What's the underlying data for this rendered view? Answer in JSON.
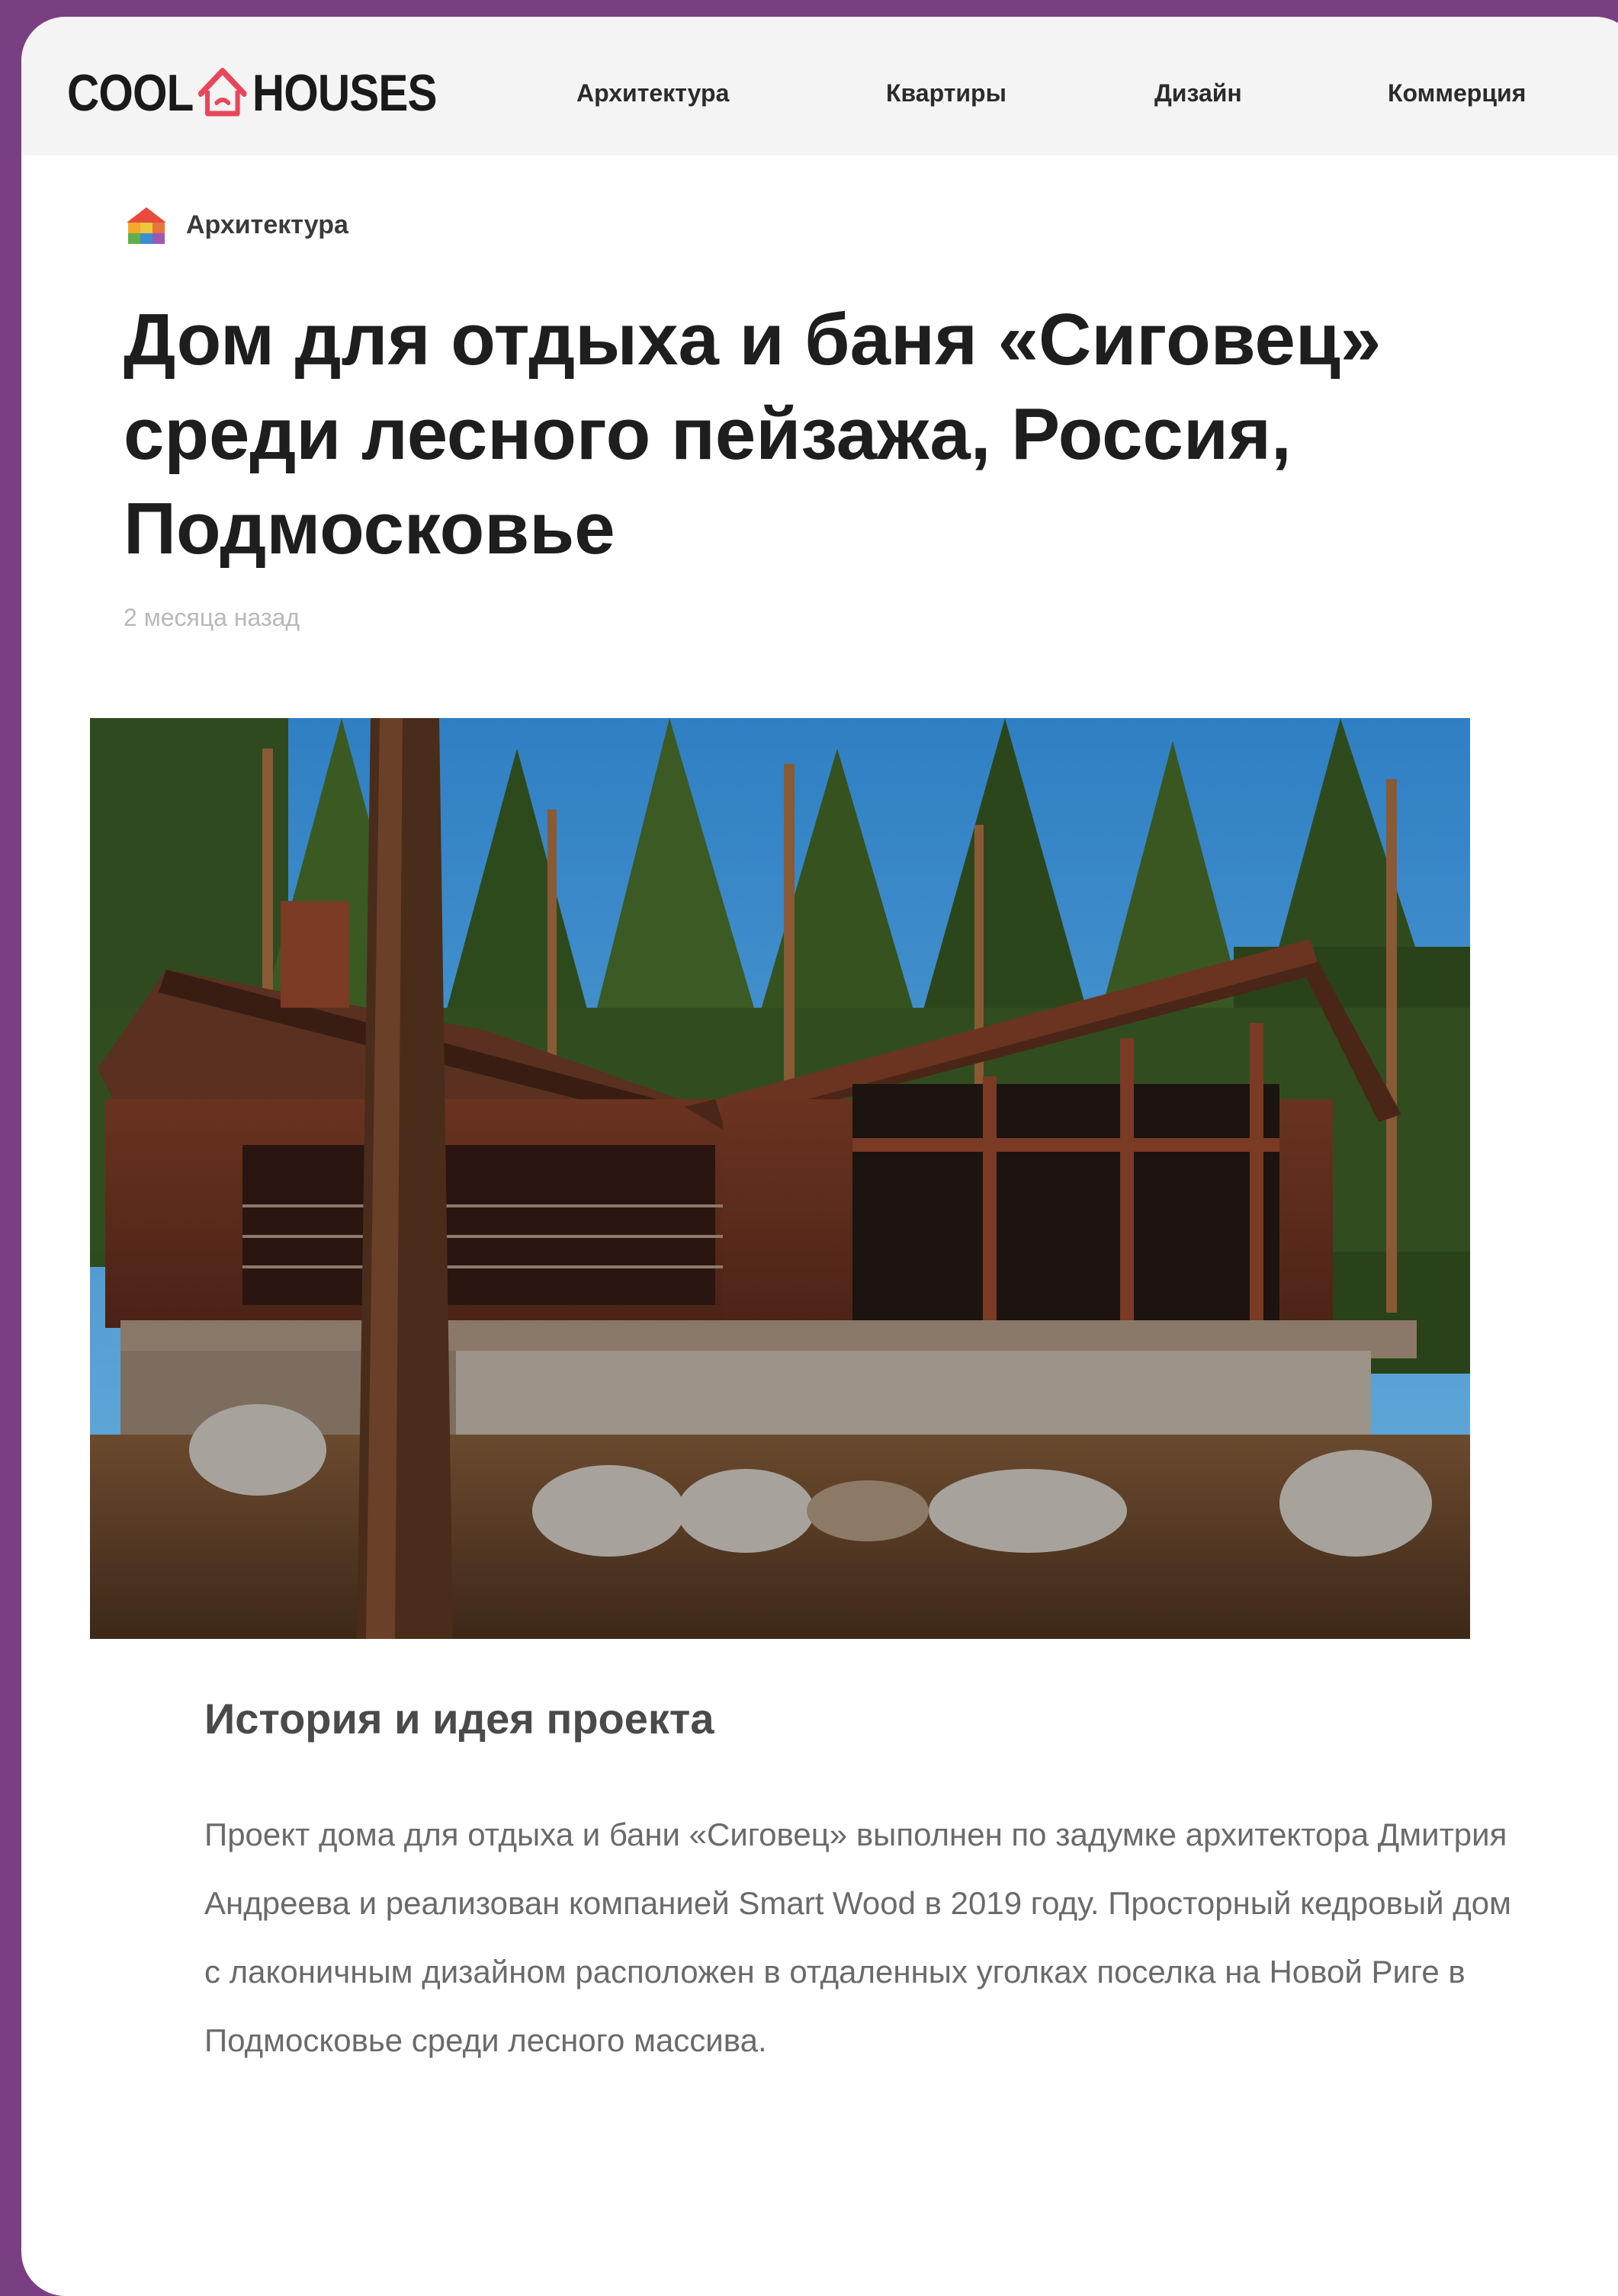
{
  "header": {
    "logo": {
      "left": "COOL",
      "right": "HOUSES"
    },
    "nav": [
      "Архитектура",
      "Квартиры",
      "Дизайн",
      "Коммерция"
    ]
  },
  "article": {
    "category": "Архитектура",
    "title": "Дом для отдыха и баня «Сиговец» среди лесного пейзажа, Россия, Подмосковье",
    "date": "2 месяца назад",
    "section_title": "История и идея проекта",
    "paragraph": "Проект дома для отдыха и бани «Сиговец» выполнен по задумке архитектора Дмитрия Андреева и реализован компанией Smart Wood в 2019 году. Просторный кедровый дом с лаконичным дизайном расположен в отдаленных уголках поселка на Новой Риге в Подмосковье среди лесного массива."
  },
  "colors": {
    "outer_background": "#7a3f82",
    "logo_accent": "#e8465a"
  }
}
